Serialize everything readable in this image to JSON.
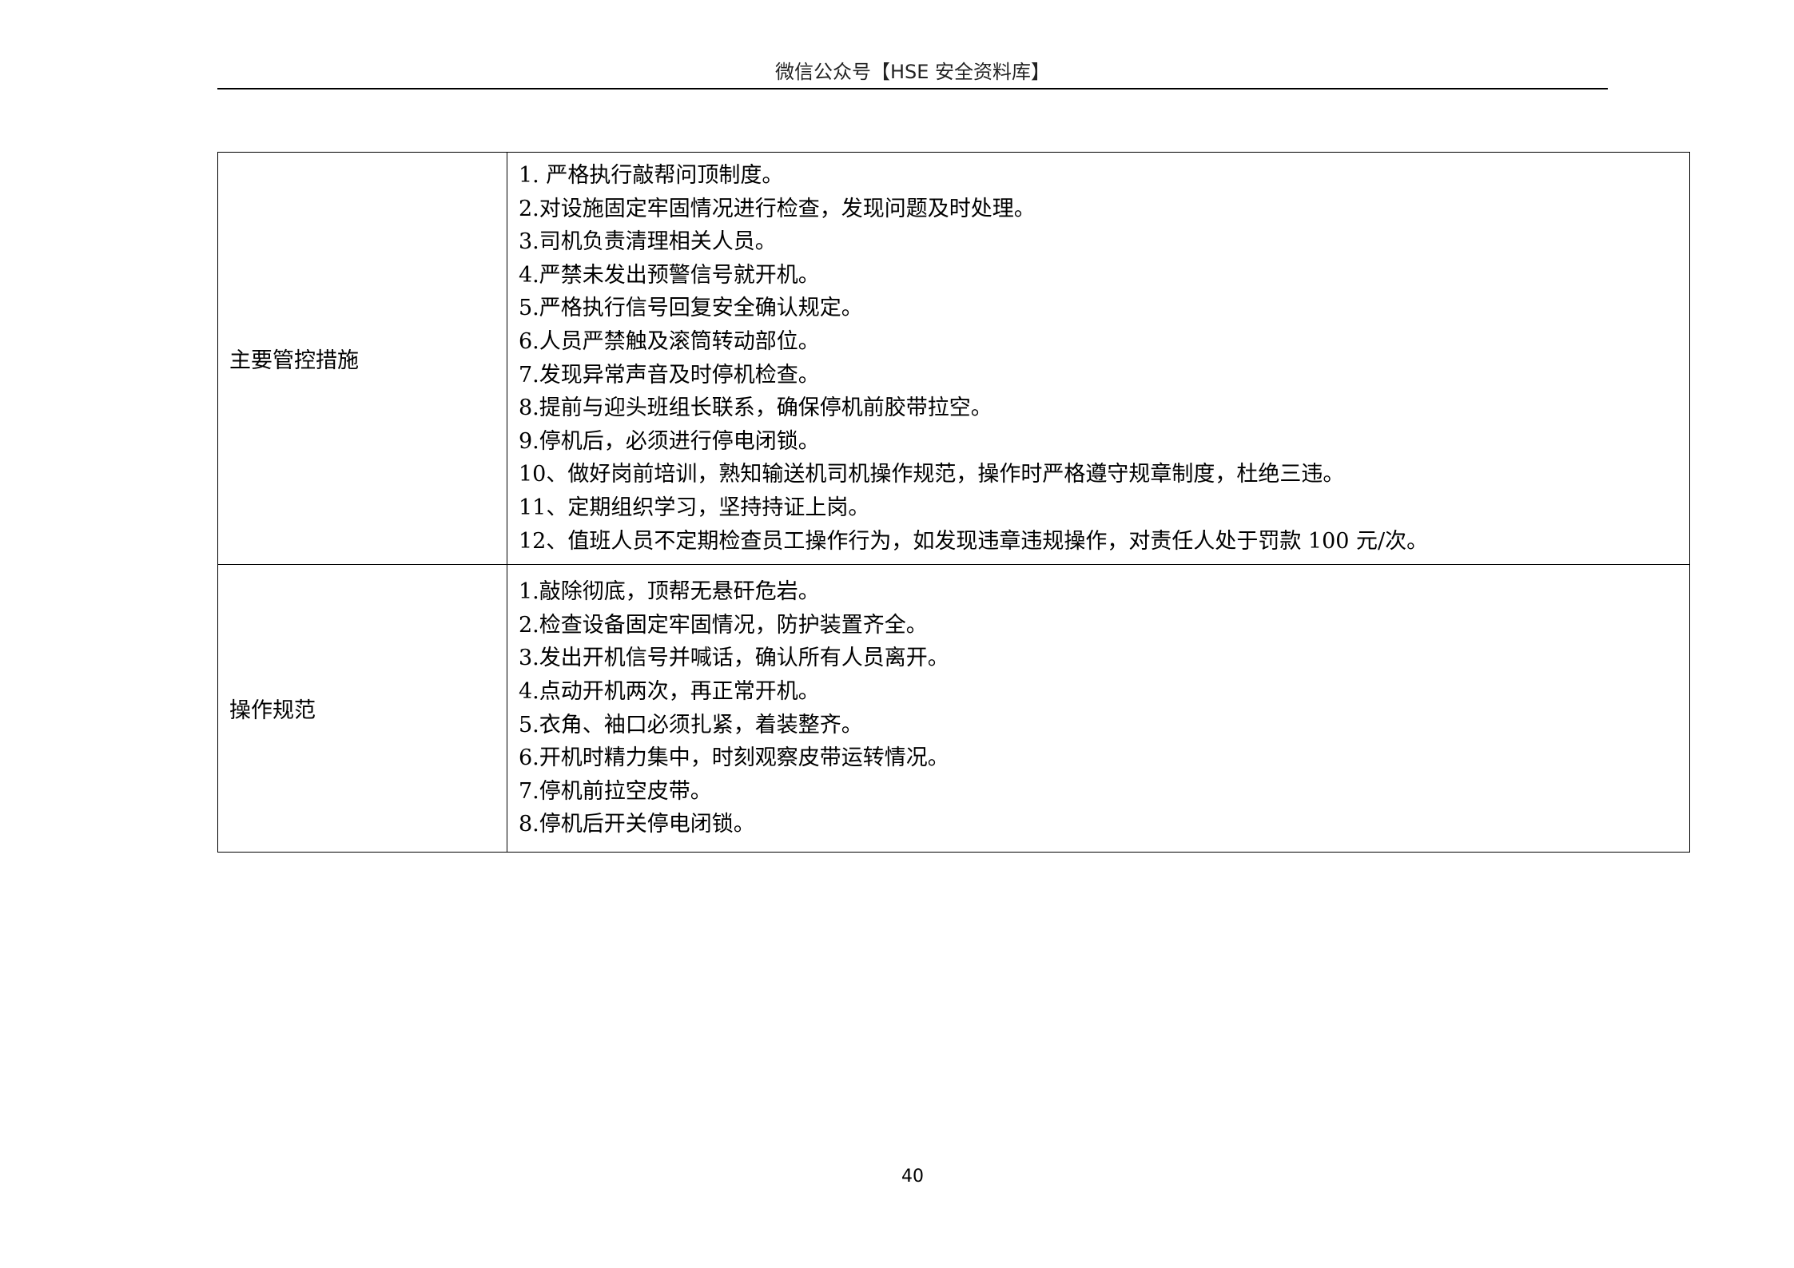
{
  "header": {
    "text": "微信公众号【HSE 安全资料库】"
  },
  "table": {
    "rows": [
      {
        "label": "主要管控措施",
        "items": [
          "1.  严格执行敲帮问顶制度。",
          "2.对设施固定牢固情况进行检查，发现问题及时处理。",
          "3.司机负责清理相关人员。",
          "4.严禁未发出预警信号就开机。",
          "5.严格执行信号回复安全确认规定。",
          "6.人员严禁触及滚筒转动部位。",
          "7.发现异常声音及时停机检查。",
          "8.提前与迎头班组长联系，确保停机前胶带拉空。",
          "9.停机后，必须进行停电闭锁。",
          "10、做好岗前培训，熟知输送机司机操作规范，操作时严格遵守规章制度，杜绝三违。",
          "11、定期组织学习，坚持持证上岗。",
          "12、值班人员不定期检查员工操作行为，如发现违章违规操作，对责任人处于罚款 100 元/次。"
        ]
      },
      {
        "label": "操作规范",
        "items": [
          "1.敲除彻底，顶帮无悬矸危岩。",
          "2.检查设备固定牢固情况，防护装置齐全。",
          "3.发出开机信号并喊话，确认所有人员离开。",
          "4.点动开机两次，再正常开机。",
          "5.衣角、袖口必须扎紧，着装整齐。",
          "6.开机时精力集中，时刻观察皮带运转情况。",
          "7.停机前拉空皮带。",
          "8.停机后开关停电闭锁。"
        ]
      }
    ]
  },
  "footer": {
    "page_number": "40"
  }
}
